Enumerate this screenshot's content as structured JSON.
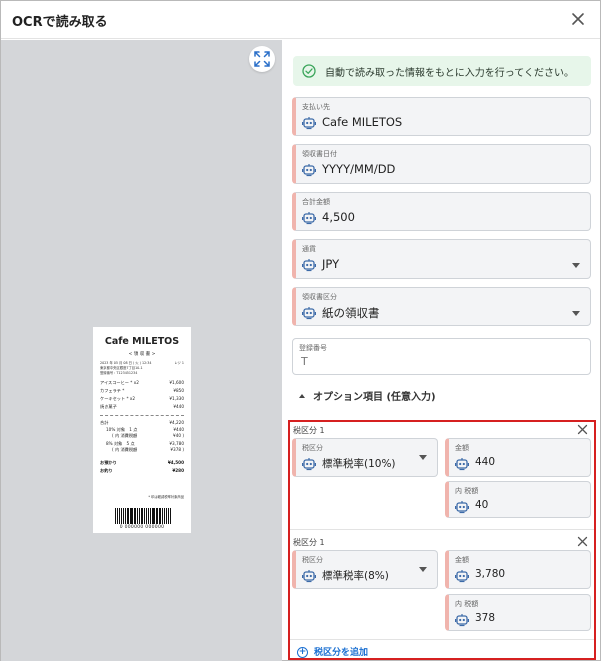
{
  "dialog": {
    "title": "OCRで読み取る"
  },
  "receipt": {
    "store": "Cafe MILETOS",
    "title": "< 領 収 書 >",
    "datetime": "2023 年 05 月 08 日 ( 火 ) 12:34",
    "register": "レジ 1",
    "address": "東京都中央区銀座7丁目10-1",
    "reg_no": "登録番号 : T123451234",
    "items": [
      {
        "name": "アイスコーヒー * x2",
        "price": "¥1,600"
      },
      {
        "name": "カフェラテ *",
        "price": "¥850"
      },
      {
        "name": "ケーキセット * x2",
        "price": "¥1,330"
      },
      {
        "name": "焼き菓子",
        "price": "¥440"
      }
    ],
    "total_label": "合計",
    "total": "¥4,220",
    "tax10": "10% 対象　1 点",
    "tax10_value": "¥440",
    "tax10_sub": "( 内 消費税額",
    "tax10_sub_value": "¥40 )",
    "tax8": "8% 対象　5 点",
    "tax8_value": "¥3,780",
    "tax8_sub": "( 内 消費税額",
    "tax8_sub_value": "¥378 )",
    "paid_label": "お預かり",
    "paid": "¥4,500",
    "change_label": "お釣り",
    "change": "¥280",
    "note": "* 印は軽減税率対象商品",
    "barcode_digits": "0 000000 000000"
  },
  "alert": {
    "text": "自動で読み取った情報をもとに入力を行ってください。"
  },
  "fields": {
    "payee": {
      "label": "支払い先",
      "value": "Cafe MILETOS"
    },
    "receipt_date": {
      "label": "領収書日付",
      "value": "YYYY/MM/DD"
    },
    "total": {
      "label": "合計金額",
      "value": "4,500"
    },
    "currency": {
      "label": "通貨",
      "value": "JPY"
    },
    "receipt_type": {
      "label": "領収書区分",
      "value": "紙の領収書"
    },
    "reg_number": {
      "label": "登録番号",
      "value": "T"
    }
  },
  "options": {
    "label": "オプション項目 (任意入力)"
  },
  "tax_groups": [
    {
      "title": "税区分 1",
      "category_label": "税区分",
      "category_value": "標準税率(10%)",
      "amount_label": "金額",
      "amount_value": "440",
      "tax_label": "内 税額",
      "tax_value": "40"
    },
    {
      "title": "税区分 1",
      "category_label": "税区分",
      "category_value": "標準税率(8%)",
      "amount_label": "金額",
      "amount_value": "3,780",
      "tax_label": "内 税額",
      "tax_value": "378"
    }
  ],
  "add_tax": {
    "label": "税区分を追加"
  },
  "colors": {
    "accent": "#1a6fd1",
    "ai_marker": "#f0b4ad",
    "alert_bg": "#e7f6ea",
    "highlight": "#d62020",
    "robot": "#3c6aa8"
  }
}
